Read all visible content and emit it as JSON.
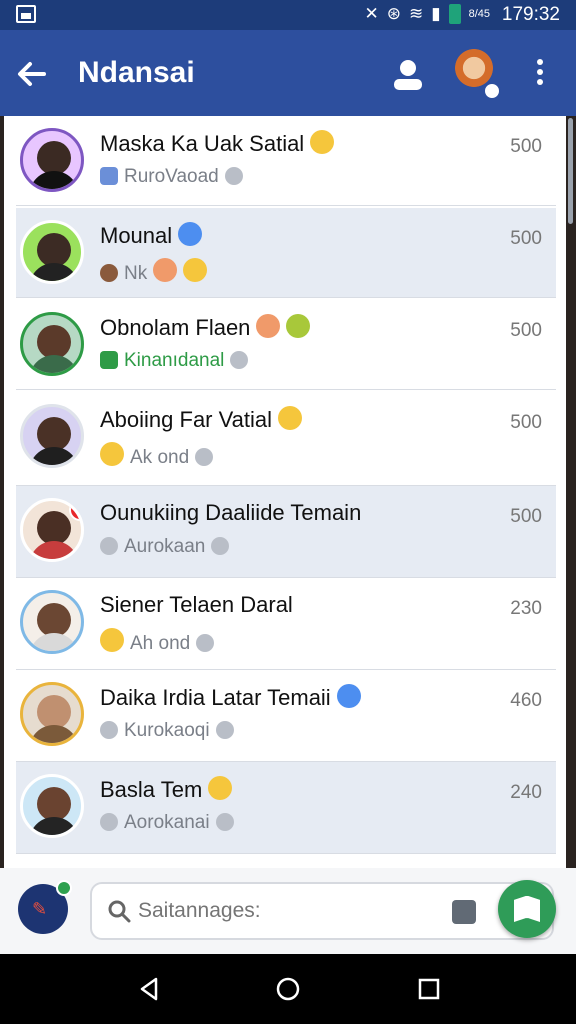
{
  "status_bar": {
    "time": "179:32",
    "small_text": "8/45",
    "icons": [
      "image-icon",
      "mute-icon",
      "network-icon",
      "wifi-icon",
      "signal-icon",
      "battery-icon"
    ]
  },
  "app_bar": {
    "title": "Ndansai",
    "icons": [
      "back-arrow-icon",
      "contact-icon",
      "avatar",
      "more-icon"
    ]
  },
  "conversations": [
    {
      "name": "Maska Ka Uak Satial",
      "subtitle": "RuroVaoad",
      "count": "500",
      "shaded": false,
      "subtitle_color": "#7a7f88"
    },
    {
      "name": "Mounal",
      "subtitle": "Nk",
      "count": "500",
      "shaded": true,
      "subtitle_color": "#7a7f88"
    },
    {
      "name": "Obnolam Flaen",
      "subtitle": "Kinanıdanal",
      "count": "500",
      "shaded": false,
      "subtitle_color": "#2e9b46"
    },
    {
      "name": "Aboiing Far Vatial",
      "subtitle": "Ak  ond",
      "count": "500",
      "shaded": false,
      "subtitle_color": "#7a7f88"
    },
    {
      "name": "Ounukiing Daaliide Temain",
      "subtitle": "Aurokaan",
      "count": "500",
      "shaded": true,
      "subtitle_color": "#7a7f88"
    },
    {
      "name": "Siener Telaen Daral",
      "subtitle": "Ah  ond",
      "count": "230",
      "shaded": false,
      "subtitle_color": "#7a7f88"
    },
    {
      "name": "Daika Irdia Latar Temaii",
      "subtitle": "Kurokaoqi",
      "count": "460",
      "shaded": false,
      "subtitle_color": "#7a7f88"
    },
    {
      "name": "Basla Tem",
      "subtitle": "Aorokanai",
      "count": "240",
      "shaded": true,
      "subtitle_color": "#7a7f88"
    }
  ],
  "search": {
    "placeholder": "Saitannages:"
  },
  "colors": {
    "app_bar": "#2d4f9e",
    "status_bar": "#1d3c7a",
    "fab": "#2f9c58",
    "shaded_row": "#e6ebf3"
  }
}
